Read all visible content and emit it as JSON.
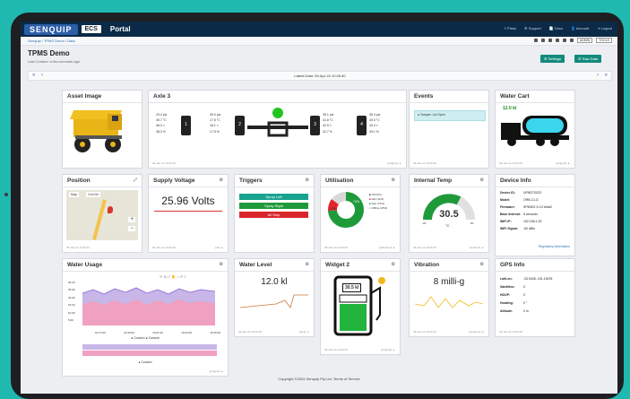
{
  "topbar": {
    "brand": "SENQUIP",
    "brand2": "ECS",
    "title": "Portal",
    "nav": [
      "≡ Plans",
      "⚙ Support",
      "📄 Docs",
      "👤 Account",
      "⇥ Logout"
    ]
  },
  "breadcrumb": "Senquip / TPMS Demo / Data",
  "crumb_tools": {
    "admin": "ADMIN",
    "tools": "TOOLS"
  },
  "page": {
    "title": "TPMS Demo",
    "subtitle": "Last Contact: a few seconds ago",
    "settings": "⚙ Settings",
    "raw": "☰ Raw Data"
  },
  "datebar": {
    "label": "Latest Data: 09-Apr-24 10:26:40"
  },
  "cards": {
    "asset_image": {
      "title": "Asset Image"
    },
    "axle": {
      "title": "Axle 3",
      "footer": "09-Jan-24 10:26:40",
      "footer_r": "[widget1] ▲",
      "tyres": [
        {
          "n": "1",
          "psi": "29.0 psi",
          "t": "49.7 °C",
          "a": "48.3 ×",
          "b": "48.3 %"
        },
        {
          "n": "2",
          "psi": "30.0 psi",
          "t": "17.6 °C",
          "a": "18.1 ×",
          "b": "17.5 %"
        },
        {
          "n": "3",
          "psi": "35.1 psi",
          "t": "41.8 °C",
          "a": "42.0 ×",
          "b": "42.7 %"
        },
        {
          "n": "4",
          "psi": "35.4 psi",
          "t": "49.0 °C",
          "a": "49.4 ×",
          "b": "49.1 %"
        }
      ]
    },
    "events": {
      "title": "Events",
      "item": "Tamper: Lid Open",
      "footer": "09-Jan-24 10:26:40"
    },
    "water_cart": {
      "title": "Water Cart",
      "value": "12.0 kl",
      "footer": "09-Jan-24 10:26:40",
      "footer_r": "[widget3] ▲"
    },
    "position": {
      "title": "Position",
      "map": "Map",
      "sat": "Satellite",
      "footer": "09-Jan-24 10:26:40"
    },
    "supply": {
      "title": "Supply Voltage",
      "value": "25.96 Volts",
      "footer": "09-Jan-24 10:26:40",
      "footer_r": "[vsi] ▲"
    },
    "triggers": {
      "title": "Triggers",
      "buttons": [
        "Spray Left",
        "Spray Right",
        "All Stop"
      ]
    },
    "utilisation": {
      "title": "Utilisation",
      "legend": [
        "Off (0%)",
        "Idle (11%)",
        "Run (74%)",
        "Offline (15%)"
      ],
      "pct": "15%",
      "pct2": "74%",
      "footer": "09-Jan-24 10:26:40",
      "footer_r": "[utilisation] ▲"
    },
    "internal_temp": {
      "title": "Internal Temp",
      "value": "30.5",
      "unit": "°C",
      "min": "-20",
      "max": "60",
      "footer": "09-Jan-24 10:26:40",
      "footer_r": "[ambient] ▲"
    },
    "device_info": {
      "title": "Device Info",
      "rows": [
        [
          "Device ID:",
          "UPNDT0023"
        ],
        [
          "Model:",
          "ORB-C1-D"
        ],
        [
          "Firmware:",
          "SPM002 3.0.0 beta2"
        ],
        [
          "Base Interval:",
          "5 seconds"
        ],
        [
          "WiFi IP:",
          "192.168.1.33"
        ],
        [
          "WiFi Signal:",
          "-50 dBm"
        ]
      ],
      "link": "Regulatory Information"
    },
    "water_usage": {
      "title": "Water Usage",
      "legend1": "● Custom  ● Custom",
      "legend2": "● Custom",
      "footer": "[usage1] ▲",
      "xticks": [
        "10:17:00",
        "10:19:00",
        "10:21:00",
        "10:23:00",
        "10:25:00"
      ],
      "yticks": [
        "30.00",
        "25.00",
        "20.00",
        "15.00",
        "10.00",
        "5.00"
      ]
    },
    "water_level": {
      "title": "Water Level",
      "value": "12.0 kl",
      "footer": "09-Jan-24 10:26:40",
      "footer_r": "[tank] ▲"
    },
    "widget2": {
      "title": "Widget 2",
      "value": "30.5 kl",
      "footer": "09-Jan-24 10:26:40",
      "footer_r": "[widget1] ▲"
    },
    "vibration": {
      "title": "Vibration",
      "value": "8 milli-g",
      "footer": "09-Jan-24 10:26:40",
      "footer_r": "[vibration] ▲"
    },
    "gps": {
      "title": "GPS Info",
      "rows": [
        [
          "Lat/Lon:",
          "-33.5436, 151.13678"
        ],
        [
          "Satellites:",
          "0"
        ],
        [
          "HDOP:",
          "0"
        ],
        [
          "Heading:",
          "0 °"
        ],
        [
          "Altitude:",
          "0 m"
        ]
      ],
      "footer": "09-Jan-24 10:26:40"
    }
  },
  "copyright": "Copyright ©2024 Senquip Pty Ltd. Terms of Service"
}
